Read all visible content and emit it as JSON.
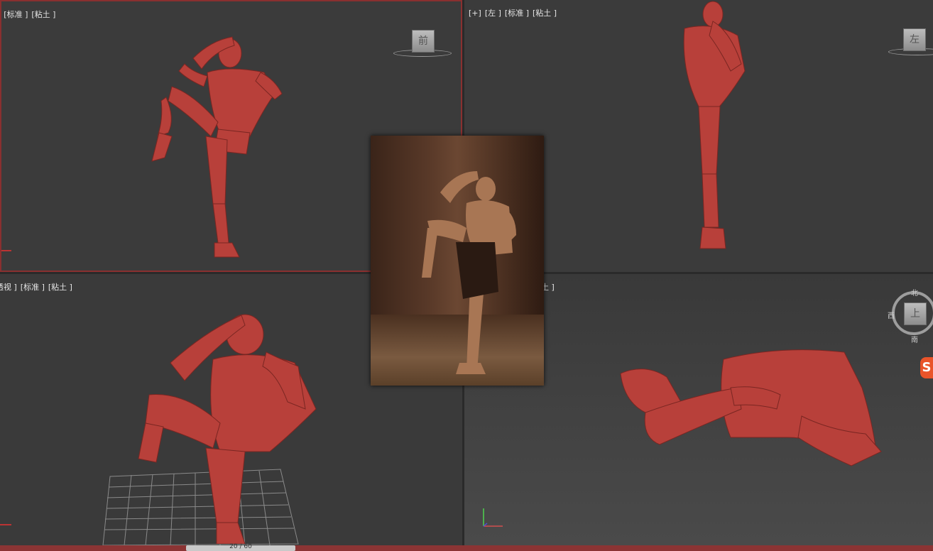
{
  "viewports": {
    "front": {
      "labels": [
        "]",
        "[标准 ]",
        "[粘土 ]"
      ],
      "cube": "前"
    },
    "left": {
      "labels": [
        "[+]",
        "[左 ]",
        "[标准 ]",
        "[粘土 ]"
      ],
      "cube": "左"
    },
    "persp": {
      "labels": [
        "透视 ]",
        "[标准 ]",
        "[粘土 ]"
      ]
    },
    "top": {
      "labels": [
        "土 ]"
      ],
      "cube": "上",
      "compass": {
        "n": "北",
        "w": "西",
        "s": "南"
      }
    }
  },
  "time_slider": "20 / 60",
  "colors": {
    "clay": "#b8403a",
    "active_border": "#8a3030",
    "viewport_bg": "#3b3b3b"
  },
  "icons": {
    "sougou": "sougou-s-icon"
  },
  "sougou_glyph": "S"
}
